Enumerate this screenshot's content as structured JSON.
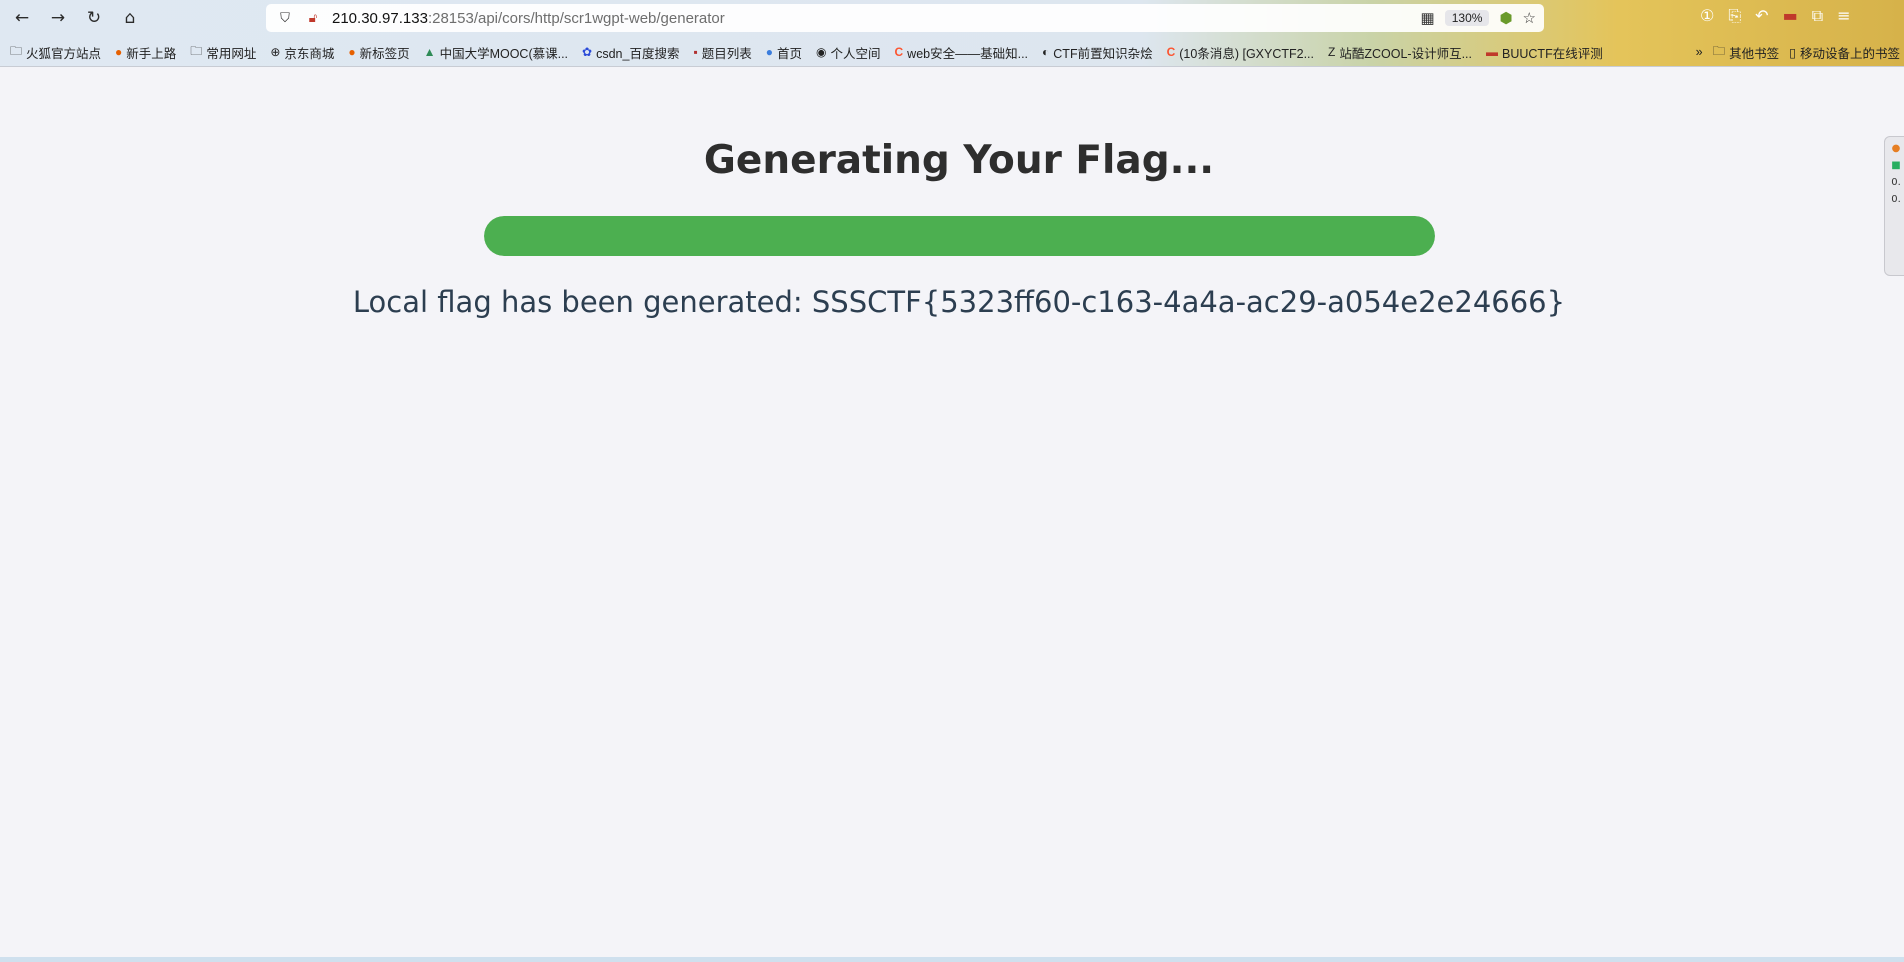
{
  "browser": {
    "url_host": "210.30.97.133",
    "url_path": ":28153/api/cors/http/scr1wgpt-web/generator",
    "zoom": "130%",
    "bookmarks": [
      {
        "icon": "folder-icon",
        "label": "火狐官方站点"
      },
      {
        "icon": "firefox-icon",
        "label": "新手上路"
      },
      {
        "icon": "folder-icon",
        "label": "常用网址"
      },
      {
        "icon": "globe-icon",
        "label": "京东商城"
      },
      {
        "icon": "firefox-icon",
        "label": "新标签页"
      },
      {
        "icon": "mooc-icon",
        "label": "中国大学MOOC(慕课..."
      },
      {
        "icon": "baidu-icon",
        "label": "csdn_百度搜索"
      },
      {
        "icon": "list-icon",
        "label": "题目列表"
      },
      {
        "icon": "home-icon",
        "label": "首页"
      },
      {
        "icon": "user-icon",
        "label": "个人空间"
      },
      {
        "icon": "csdn-icon",
        "label": "web安全——基础知..."
      },
      {
        "icon": "ctf-icon",
        "label": "CTF前置知识杂烩"
      },
      {
        "icon": "csdn-icon",
        "label": "(10条消息) [GXYCTF2..."
      },
      {
        "icon": "zcool-icon",
        "label": "站酷ZCOOL-设计师互..."
      },
      {
        "icon": "buu-icon",
        "label": "BUUCTF在线评测"
      }
    ],
    "bookmarks_right": [
      {
        "icon": "folder-icon",
        "label": "其他书签"
      },
      {
        "icon": "mobile-icon",
        "label": "移动设备上的书签"
      }
    ],
    "side_widget": [
      "0.",
      "0."
    ]
  },
  "page": {
    "title": "Generating Your Flag...",
    "progress_percent": 100,
    "message": "Local flag has been generated: SSSCTF{5323ff60-c163-4a4a-ac29-a054e2e24666}"
  },
  "colors": {
    "progress_fill": "#4caf50",
    "title": "#2e2e2e",
    "message": "#2c3e50",
    "background": "#f4f4f8"
  }
}
